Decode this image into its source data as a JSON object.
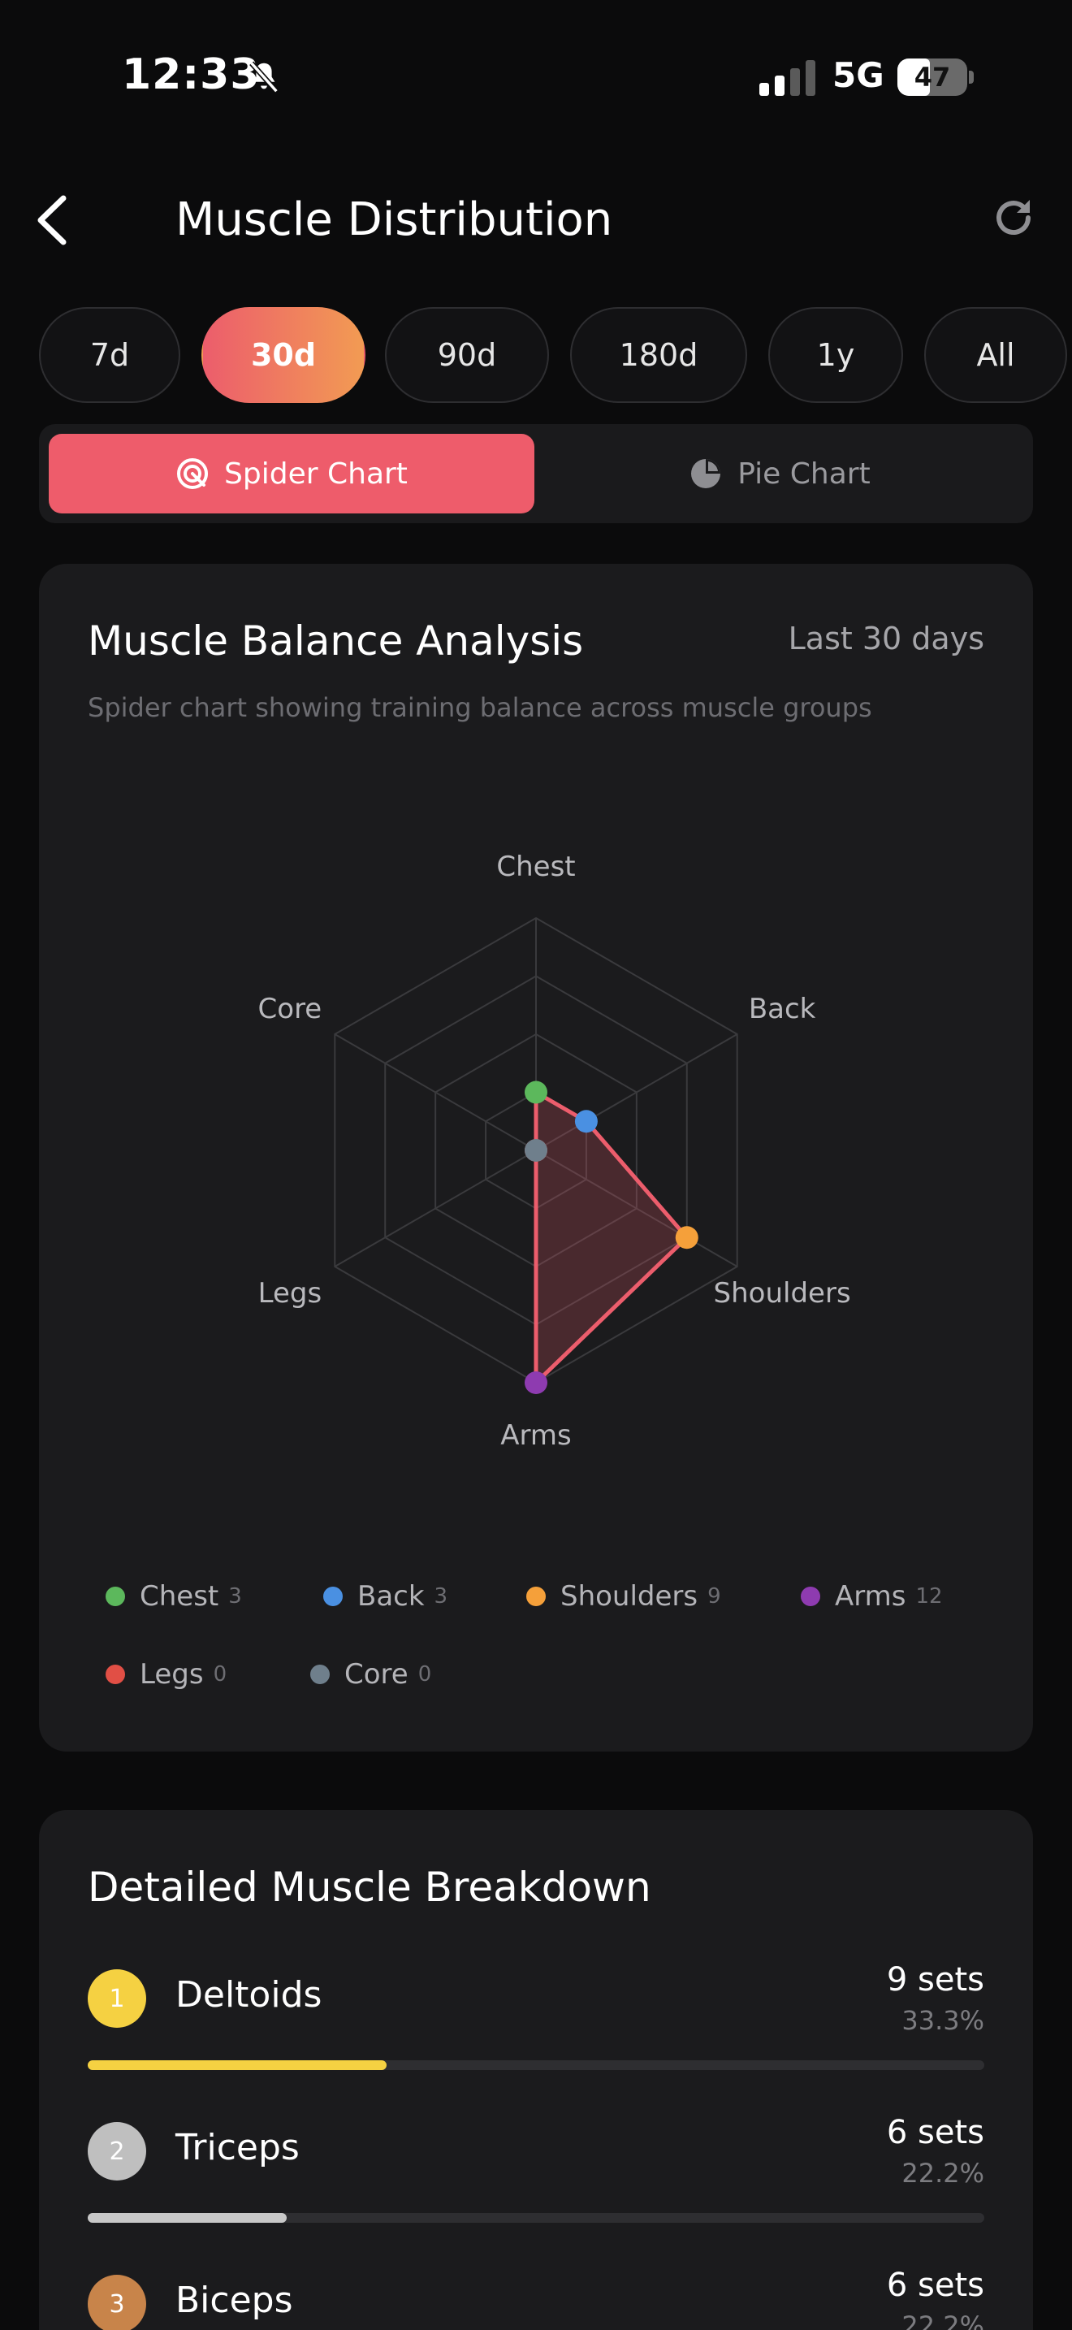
{
  "status_bar": {
    "time": "12:33",
    "network": "5G",
    "battery": "47",
    "battery_level": 0.47
  },
  "header": {
    "title": "Muscle Distribution"
  },
  "ranges": [
    {
      "label": "7d",
      "active": false
    },
    {
      "label": "30d",
      "active": true
    },
    {
      "label": "90d",
      "active": false
    },
    {
      "label": "180d",
      "active": false
    },
    {
      "label": "1y",
      "active": false
    },
    {
      "label": "All",
      "active": false
    }
  ],
  "view_toggle": {
    "spider_label": "Spider Chart",
    "pie_label": "Pie Chart",
    "active": "spider"
  },
  "spider_card": {
    "title": "Muscle Balance Analysis",
    "period": "Last 30 days",
    "subtitle": "Spider chart showing training balance across muscle groups"
  },
  "chart_data": {
    "type": "radar",
    "axes": [
      "Chest",
      "Back",
      "Shoulders",
      "Arms",
      "Legs",
      "Core"
    ],
    "values": [
      3,
      3,
      9,
      12,
      0,
      0
    ],
    "range": [
      0,
      12
    ],
    "rings": 4,
    "point_colors": [
      "#5cb85c",
      "#4a90e2",
      "#f5a03a",
      "#8e3bb0",
      "#e14f45",
      "#6f7f8c"
    ],
    "line_color": "#ec5d6c"
  },
  "legend": [
    {
      "label": "Chest",
      "value": "3",
      "color": "#5cb85c"
    },
    {
      "label": "Back",
      "value": "3",
      "color": "#4a90e2"
    },
    {
      "label": "Shoulders",
      "value": "9",
      "color": "#f5a03a"
    },
    {
      "label": "Arms",
      "value": "12",
      "color": "#8e3bb0"
    },
    {
      "label": "Legs",
      "value": "0",
      "color": "#e14f45"
    },
    {
      "label": "Core",
      "value": "0",
      "color": "#6f7f8c"
    }
  ],
  "breakdown": {
    "title": "Detailed Muscle Breakdown",
    "items": [
      {
        "rank": "1",
        "name": "Deltoids",
        "sets": "9 sets",
        "percent": "33.3%",
        "fraction": 0.333,
        "color": "#f5d142",
        "bar_color": "#f5d142"
      },
      {
        "rank": "2",
        "name": "Triceps",
        "sets": "6 sets",
        "percent": "22.2%",
        "fraction": 0.222,
        "color": "#bfbfbf",
        "bar_color": "#c8c8c8"
      },
      {
        "rank": "3",
        "name": "Biceps",
        "sets": "6 sets",
        "percent": "22.2%",
        "fraction": 0.222,
        "color": "#c8844a",
        "bar_color": "#c8844a"
      }
    ]
  }
}
